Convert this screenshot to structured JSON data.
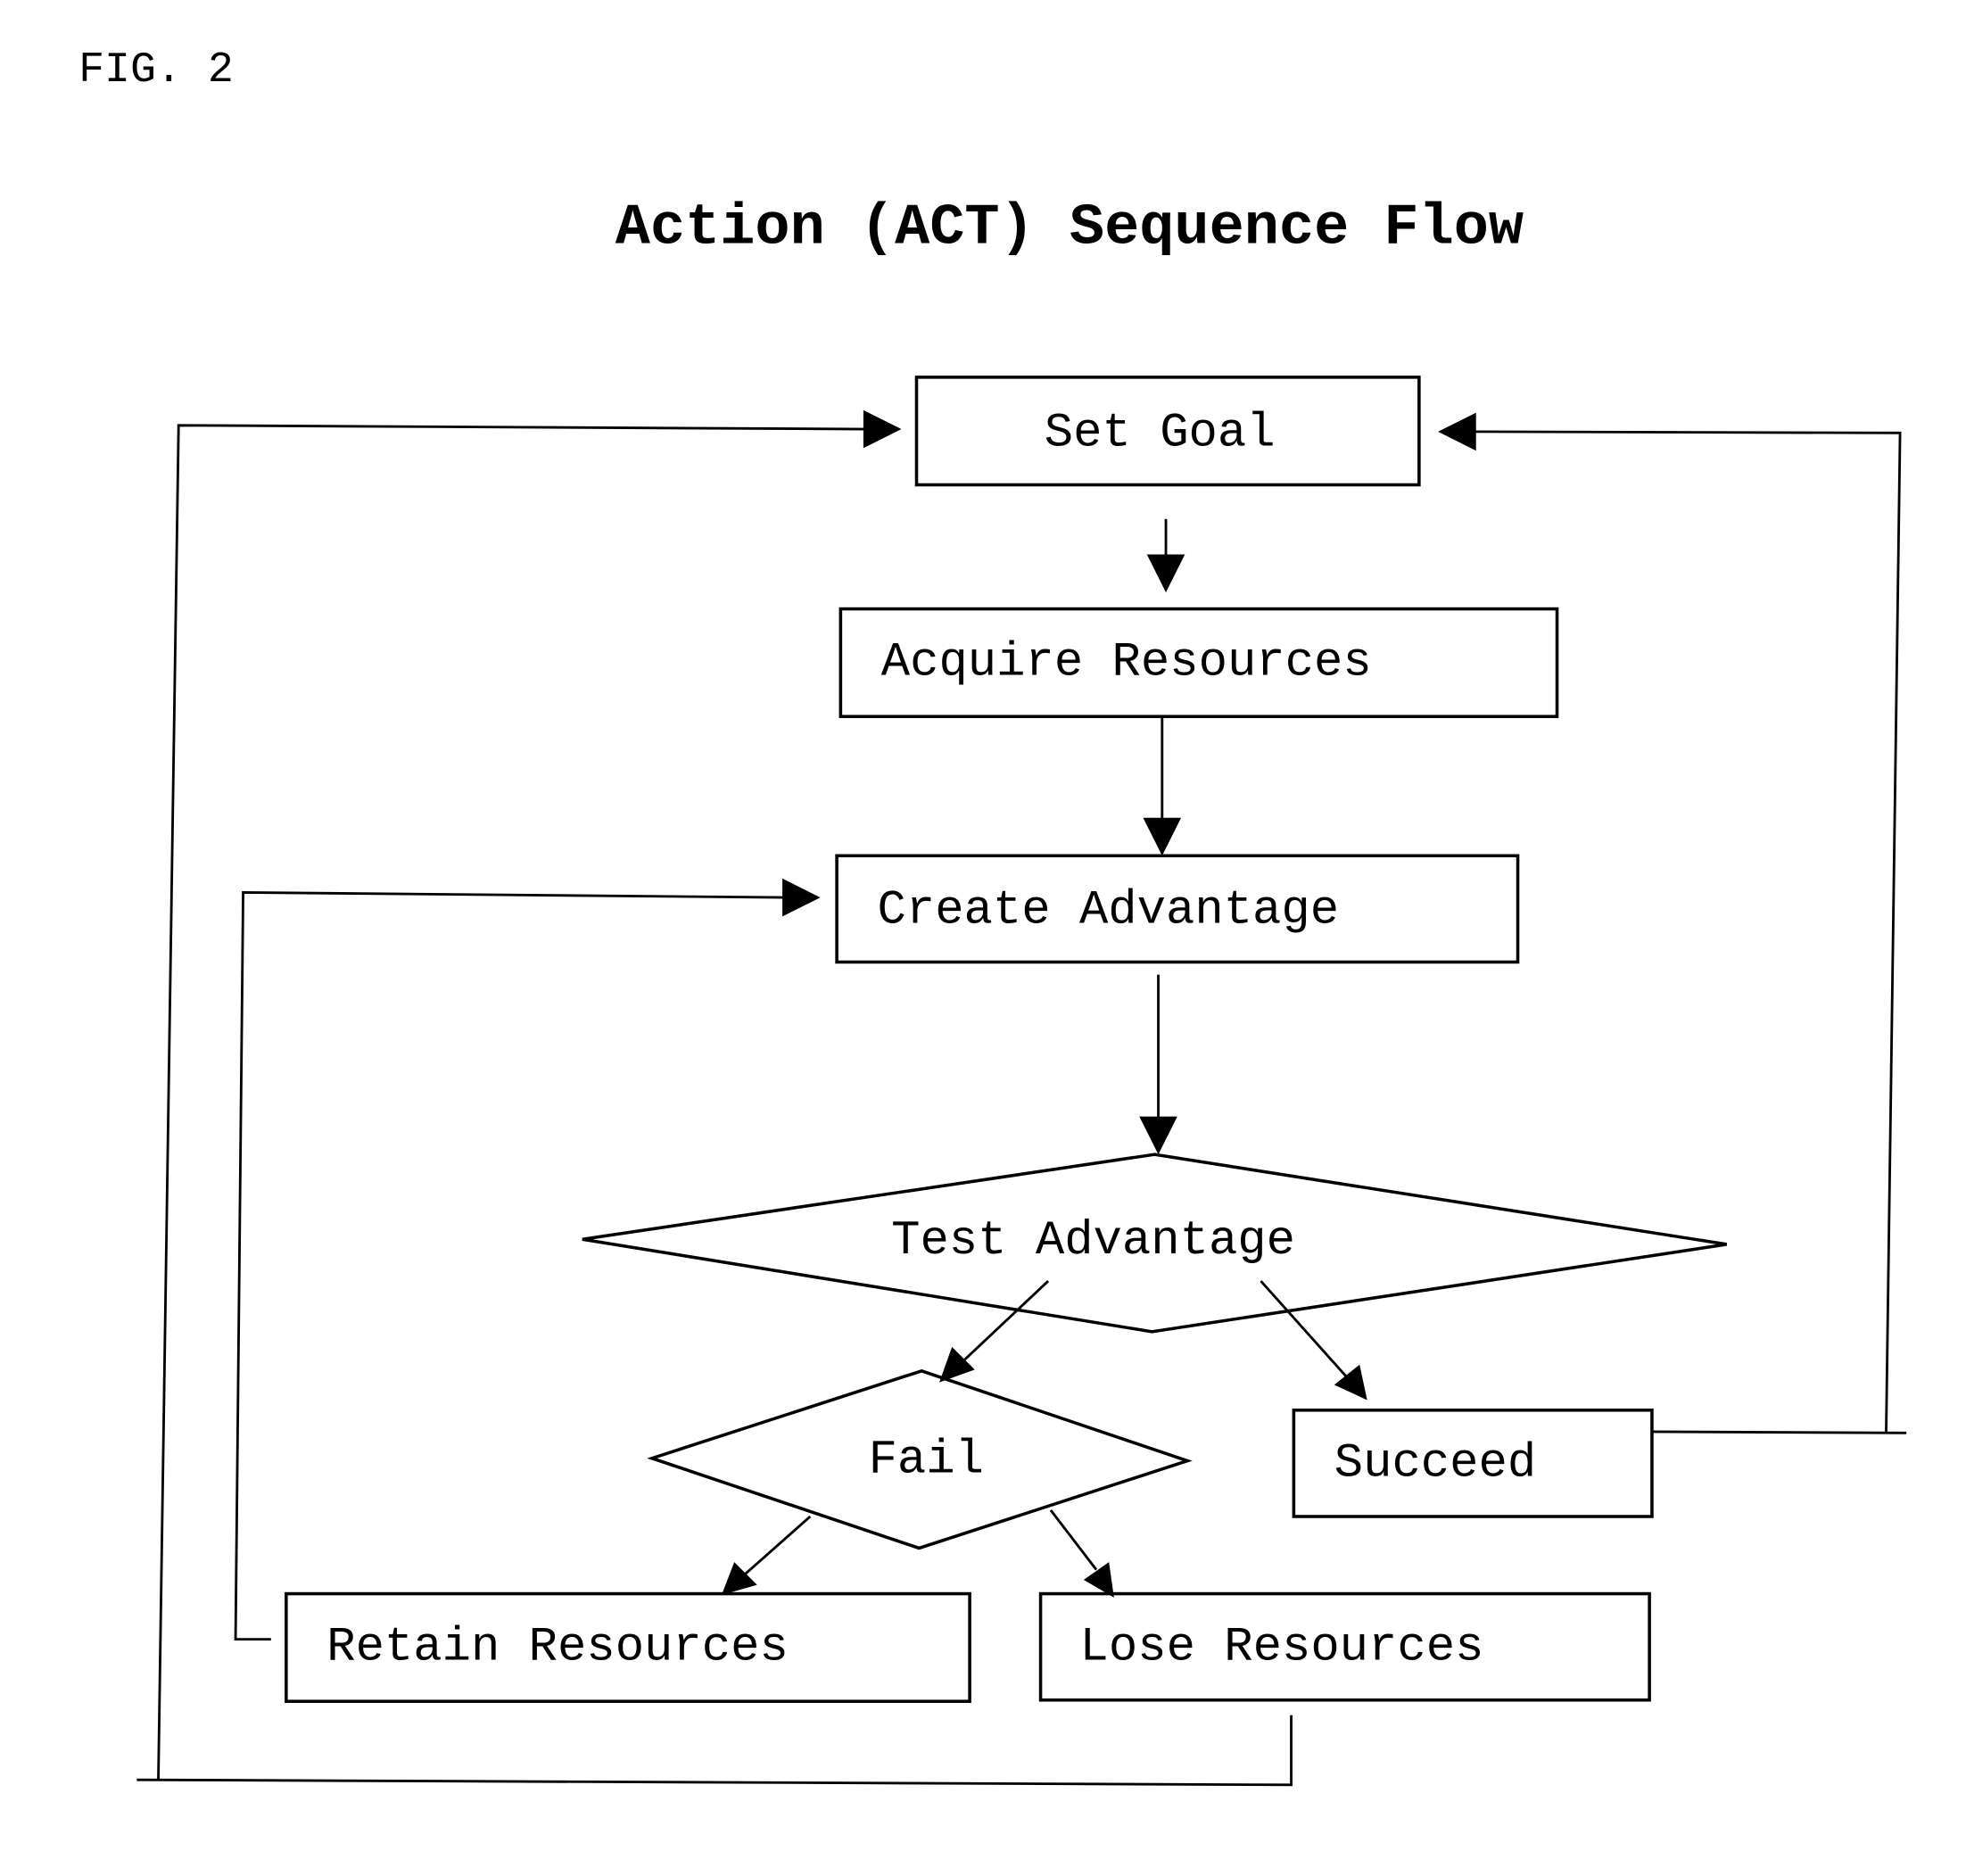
{
  "figure_label": "FIG. 2",
  "title": "Action (ACT) Sequence Flow",
  "nodes": {
    "set_goal": "Set Goal",
    "acquire_resources": "Acquire Resources",
    "create_advantage": "Create Advantage",
    "test_advantage": "Test Advantage",
    "fail": "Fail",
    "succeed": "Succeed",
    "retain_resources": "Retain Resources",
    "lose_resources": "Lose Resources"
  },
  "edges": [
    {
      "from": "Set Goal",
      "to": "Acquire Resources"
    },
    {
      "from": "Acquire Resources",
      "to": "Create Advantage"
    },
    {
      "from": "Create Advantage",
      "to": "Test Advantage"
    },
    {
      "from": "Test Advantage",
      "to": "Fail"
    },
    {
      "from": "Test Advantage",
      "to": "Succeed"
    },
    {
      "from": "Fail",
      "to": "Retain Resources"
    },
    {
      "from": "Fail",
      "to": "Lose Resources"
    },
    {
      "from": "Retain Resources",
      "to": "Create Advantage"
    },
    {
      "from": "Lose Resources",
      "to": "Set Goal"
    },
    {
      "from": "Succeed",
      "to": "Set Goal"
    }
  ]
}
